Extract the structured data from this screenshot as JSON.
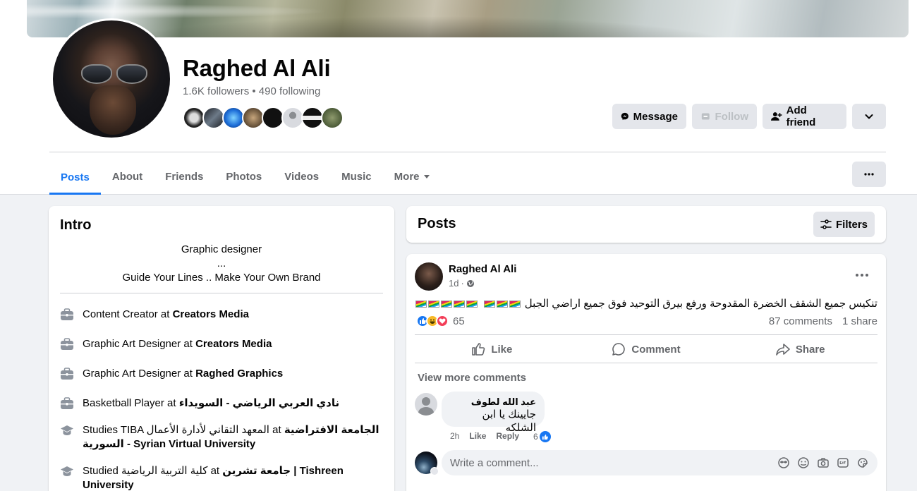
{
  "profile": {
    "name": "Raghed Al Ali",
    "stats": "1.6K followers • 490 following"
  },
  "actions": {
    "message": "Message",
    "follow": "Follow",
    "add_friend": "Add friend"
  },
  "tabs": [
    {
      "label": "Posts"
    },
    {
      "label": "About"
    },
    {
      "label": "Friends"
    },
    {
      "label": "Photos"
    },
    {
      "label": "Videos"
    },
    {
      "label": "Music"
    },
    {
      "label": "More"
    }
  ],
  "intro": {
    "title": "Intro",
    "bio_line1": "Graphic designer",
    "bio_line2": "...",
    "bio_line3": "Guide Your Lines .. Make Your Own Brand",
    "items": [
      {
        "prefix": "Content Creator at ",
        "bold": "Creators Media",
        "icon": "briefcase-icon"
      },
      {
        "prefix": "Graphic Art Designer at ",
        "bold": "Creators Media",
        "icon": "briefcase-icon"
      },
      {
        "prefix": "Graphic Art Designer at ",
        "bold": "Raghed Graphics",
        "icon": "briefcase-icon"
      },
      {
        "prefix": "Basketball Player at ",
        "bold": "نادي العربي الرياضي - السويداء",
        "icon": "briefcase-icon"
      },
      {
        "prefix": "Studies TIBA المعهد التقاني لأدارة الأعمال at ",
        "bold": "الجامعة الافتراضية السورية - Syrian Virtual University",
        "icon": "graduation-cap-icon"
      },
      {
        "prefix": "Studied كلية التربية الرياضية at ",
        "bold": "جامعة تشرين | Tishreen University",
        "icon": "graduation-cap-icon"
      }
    ]
  },
  "posts_header": {
    "title": "Posts",
    "filters": "Filters"
  },
  "post": {
    "author": "Raghed Al Ali",
    "time": "1d",
    "text": "تنكيس جميع الشقف الخضرة المقدوحة ورفع بيرق التوحيد فوق جميع اراضي الجبل",
    "reaction_count": "65",
    "comments": "87 comments",
    "shares": "1 share",
    "like": "Like",
    "comment": "Comment",
    "share": "Share",
    "view_more": "View more comments"
  },
  "comment": {
    "author": "عبد الله لطوف",
    "text": "جايينك يا ابن الشلكه",
    "time": "2h",
    "like": "Like",
    "reply": "Reply",
    "likes": "6"
  },
  "composer": {
    "placeholder": "Write a comment..."
  },
  "colors": {
    "accent": "#1877f2",
    "secondary_text": "#65676b",
    "background": "#f0f2f5"
  }
}
